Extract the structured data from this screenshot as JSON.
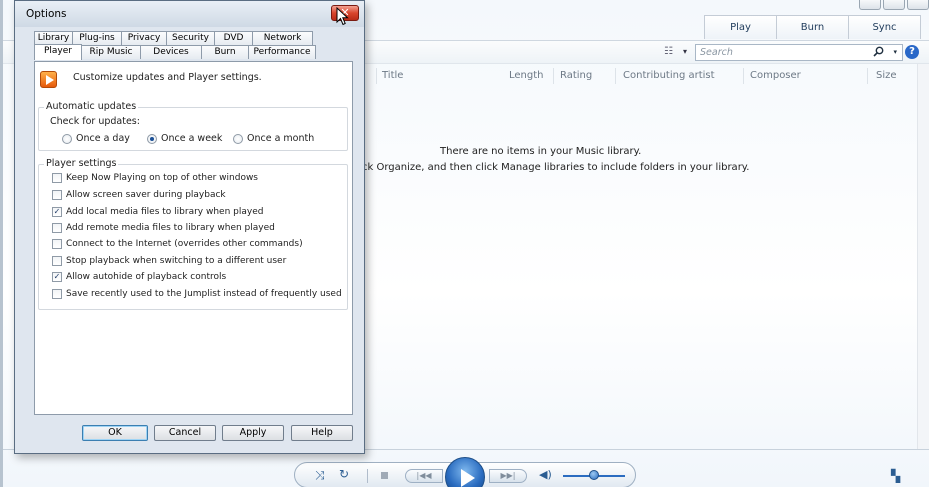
{
  "player": {
    "tabs": [
      "Play",
      "Burn",
      "Sync"
    ],
    "search_placeholder": "Search",
    "help": "?",
    "columns": [
      "Title",
      "Length",
      "Rating",
      "Contributing artist",
      "Composer",
      "Size"
    ],
    "empty_line1": "There are no items in your Music library.",
    "empty_line2": "ck Organize, and then click Manage libraries to include folders in your library."
  },
  "dialog": {
    "title": "Options",
    "tabs_row1": [
      "Library",
      "Plug-ins",
      "Privacy",
      "Security",
      "DVD",
      "Network"
    ],
    "tabs_row2": [
      "Player",
      "Rip Music",
      "Devices",
      "Burn",
      "Performance"
    ],
    "selected_tab": "Player",
    "description": "Customize updates and Player settings.",
    "auto_updates": {
      "legend": "Automatic updates",
      "check_label": "Check for updates:",
      "options": [
        {
          "label": "Once a day",
          "selected": false
        },
        {
          "label": "Once a week",
          "selected": true
        },
        {
          "label": "Once a month",
          "selected": false
        }
      ]
    },
    "player_settings": {
      "legend": "Player settings",
      "items": [
        {
          "label": "Keep Now Playing on top of other windows",
          "checked": false
        },
        {
          "label": "Allow screen saver during playback",
          "checked": false
        },
        {
          "label": "Add local media files to library when played",
          "checked": true
        },
        {
          "label": "Add remote media files to library when played",
          "checked": false
        },
        {
          "label": "Connect to the Internet (overrides other commands)",
          "checked": false
        },
        {
          "label": "Stop playback when switching to a different user",
          "checked": false
        },
        {
          "label": "Allow autohide of playback controls",
          "checked": true
        },
        {
          "label": "Save recently used to the Jumplist instead of frequently used",
          "checked": false
        }
      ]
    },
    "buttons": {
      "ok": "OK",
      "cancel": "Cancel",
      "apply": "Apply",
      "help": "Help"
    }
  },
  "icons": {
    "close": "✕",
    "check": "✓",
    "search": "⚲",
    "dropdown": "▾",
    "view": "☷",
    "shuffle": "⤨",
    "repeat": "↻",
    "prev": "|◀◀",
    "next": "▶▶|",
    "volume": "◀)",
    "switch_view": "▚"
  }
}
